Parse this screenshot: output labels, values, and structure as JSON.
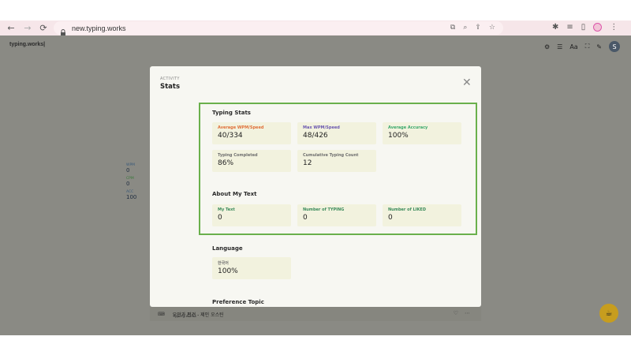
{
  "browser": {
    "url": "new.typing.works"
  },
  "site": {
    "logo": "typing.works|",
    "font_button": "Aa",
    "avatar_initial": "S",
    "side_stats": [
      {
        "label": "WPM",
        "value": "0"
      },
      {
        "label": "CPM",
        "value": "0"
      },
      {
        "label": "ACC",
        "value": "100"
      }
    ],
    "bottom_item": {
      "title": "오만과 편견 - 제인 오스틴",
      "subtitle": "typing.works"
    }
  },
  "modal": {
    "kicker": "ACTIVITY",
    "title": "Stats",
    "typing_stats": {
      "title": "Typing Stats",
      "cards": [
        {
          "label": "Average WPM/Speed",
          "value": "40/334",
          "color": "#e0703a"
        },
        {
          "label": "Max WPM/Speed",
          "value": "48/426",
          "color": "#6b58b0"
        },
        {
          "label": "Average Accuracy",
          "value": "100%",
          "color": "#3aa86b"
        },
        {
          "label": "Typing Completed",
          "value": "86%",
          "color": "#6f6f6f"
        },
        {
          "label": "Cumulative Typing Count",
          "value": "12",
          "color": "#6f6f6f"
        }
      ]
    },
    "about_text": {
      "title": "About My Text",
      "cards": [
        {
          "label": "My Text",
          "value": "0",
          "color": "#3a8a5a"
        },
        {
          "label": "Number of TYPING",
          "value": "0",
          "color": "#3a8a5a"
        },
        {
          "label": "Number of LIKED",
          "value": "0",
          "color": "#3a8a5a"
        }
      ]
    },
    "language": {
      "title": "Language",
      "card": {
        "label": "한국어",
        "value": "100%",
        "color": "#6f6f6f"
      }
    },
    "preference": {
      "title": "Preference Topic"
    }
  }
}
